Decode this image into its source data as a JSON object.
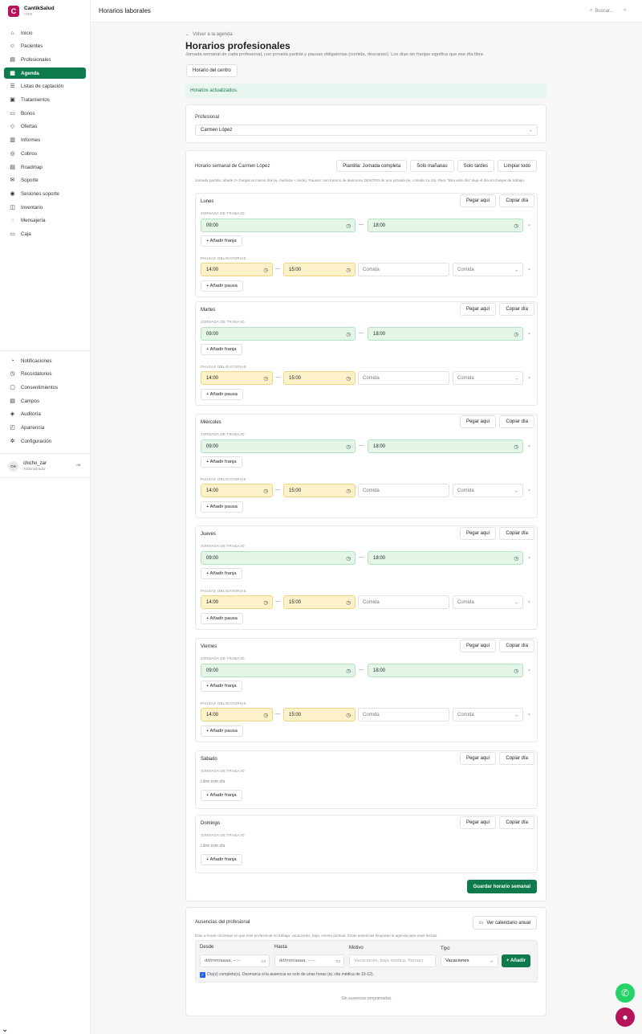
{
  "brand": {
    "name": "CantikSalud",
    "sub": "CRM",
    "logo_letter": "C",
    "color": "#b5145b"
  },
  "topbar": {
    "title": "Horarios laborales",
    "search_placeholder": "Buscar...",
    "collapse_icon": "«"
  },
  "nav": [
    {
      "label": "Inicio",
      "icon": "⌂"
    },
    {
      "label": "Pacientes",
      "icon": "☺"
    },
    {
      "label": "Profesionales",
      "icon": "▤"
    },
    {
      "label": "Agenda",
      "icon": "▦",
      "active": true
    },
    {
      "label": "Listas de captación",
      "icon": "☰"
    },
    {
      "label": "Tratamientos",
      "icon": "▣"
    },
    {
      "label": "Bonos",
      "icon": "▭"
    },
    {
      "label": "Ofertas",
      "icon": "◇"
    },
    {
      "label": "Informes",
      "icon": "▥"
    },
    {
      "label": "Cobros",
      "icon": "◎"
    },
    {
      "label": "Roadmap",
      "icon": "▤"
    },
    {
      "label": "Soporte",
      "icon": "✉"
    },
    {
      "label": "Sesiones soporte",
      "icon": "◉"
    },
    {
      "label": "Inventario",
      "icon": "◫"
    },
    {
      "label": "Mensajería",
      "icon": "◌"
    },
    {
      "label": "Caja",
      "icon": "▭"
    }
  ],
  "nav_bottom": [
    {
      "label": "Notificaciones",
      "icon": "◔"
    },
    {
      "label": "Recordatorios",
      "icon": "◷"
    },
    {
      "label": "Consentimientos",
      "icon": "▢"
    },
    {
      "label": "Campos",
      "icon": "▤"
    },
    {
      "label": "Auditoría",
      "icon": "◈"
    },
    {
      "label": "Apariencia",
      "icon": "◰"
    },
    {
      "label": "Configuración",
      "icon": "✲"
    }
  ],
  "user": {
    "initials": "CH",
    "name": "chicho_zar",
    "role": "Administrador",
    "logout_icon": "⇥"
  },
  "page": {
    "back": "Volver a la agenda",
    "title": "Horarios profesionales",
    "subtitle": "Jornada semanal de cada profesional, con jornada partida y pausas obligatorias (comida, descanso). Los días sin franjas significa que ese día libra",
    "centro_button": "Horario del centro",
    "alert": "Horarios actualizados."
  },
  "profesional": {
    "label": "Profesional",
    "value": "Carmen López"
  },
  "weekly": {
    "title": "Horario semanal de Carmen López",
    "buttons": [
      "Plantilla: Jornada completa",
      "Solo mañanas",
      "Solo tardes",
      "Limpiar todo"
    ],
    "hint": "Jornada partida: añade 2+ franjas al mismo día (ej. mañana + tarde). Pausas: son tramos de descanso DENTRO de una jornada (ej. comida 14-15). Para \"libre este día\" deja el día sin franjas de trabajo.",
    "paste_label": "Pegar aquí",
    "copy_label": "Copiar día",
    "jornada_label": "JORNADA DE TRABAJO",
    "pausas_label": "PAUSAS OBLIGATORIAS",
    "add_franja": "+ Añadir franja",
    "add_pausa": "+ Añadir pausa",
    "libre": "Libre este día",
    "motivo_placeholder": "Comida",
    "save": "Guardar horario semanal",
    "days": [
      {
        "name": "Lunes",
        "start": "09:00",
        "end": "18:00",
        "pausa_start": "14:00",
        "pausa_end": "15:00",
        "pausa_tipo": "Comida"
      },
      {
        "name": "Martes",
        "start": "09:00",
        "end": "18:00",
        "pausa_start": "14:00",
        "pausa_end": "15:00",
        "pausa_tipo": "Comida"
      },
      {
        "name": "Miércoles",
        "start": "09:00",
        "end": "18:00",
        "pausa_start": "14:00",
        "pausa_end": "15:00",
        "pausa_tipo": "Comida"
      },
      {
        "name": "Jueves",
        "start": "09:00",
        "end": "18:00",
        "pausa_start": "14:00",
        "pausa_end": "15:00",
        "pausa_tipo": "Comida"
      },
      {
        "name": "Viernes",
        "start": "09:00",
        "end": "18:00",
        "pausa_start": "14:00",
        "pausa_end": "15:00",
        "pausa_tipo": "Comida"
      },
      {
        "name": "Sábado",
        "libre": true
      },
      {
        "name": "Domingo",
        "libre": true
      }
    ]
  },
  "ausencias": {
    "title": "Ausencias del profesional",
    "calendar_button": "Ver calendario anual",
    "hint": "Días u horas concretas en que este profesional no trabaja: vacaciones, baja, evento puntual. Estas ausencias bloquean la agenda para esas fechas.",
    "desde_label": "Desde",
    "hasta_label": "Hasta",
    "motivo_label": "Motivo",
    "tipo_label": "Tipo",
    "date_placeholder": "dd/mm/aaaa, --:--",
    "motivo_placeholder": "Vacaciones, baja médica, formaci",
    "tipo_value": "Vacaciones",
    "add_button": "+ Añadir",
    "checkbox_label": "Día(s) completo(s). Desmarca si la ausencia es solo de unas horas (ej. cita médica de 10-12).",
    "empty": "Sin ausencias programadas."
  },
  "colors": {
    "accent": "#0f7a4d",
    "whatsapp": "#25d366",
    "chat": "#b5145b"
  }
}
